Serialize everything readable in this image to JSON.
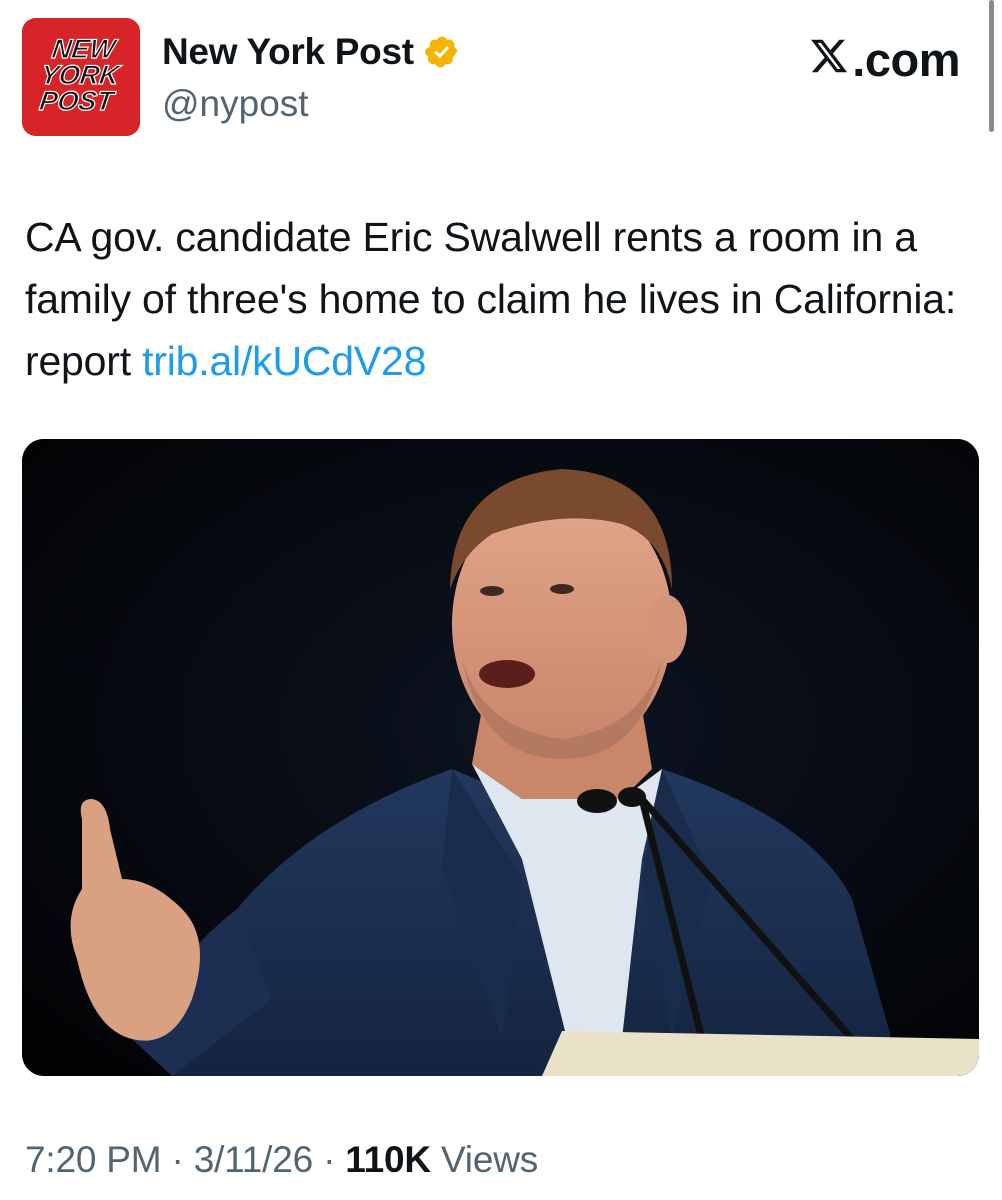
{
  "account": {
    "display_name": "New York Post",
    "handle": "@nypost",
    "verified_badge_color": "#f4b400",
    "avatar_bg_color": "#d62428",
    "avatar_logo_lines": [
      "NEW",
      "YORK",
      "POST"
    ]
  },
  "site_label": ".com",
  "tweet": {
    "text": "CA gov. candidate Eric Swalwell rents a room in a family of three's home to claim he lives in California: report ",
    "link": "trib.al/kUCdV28",
    "link_color": "#1d9bf0"
  },
  "meta": {
    "time": "7:20 PM",
    "separator": " · ",
    "date": "3/11/26",
    "views_count": "110K",
    "views_label": " Views"
  },
  "icons": {
    "verified": "verified-badge-icon",
    "x_logo": "x-logo-icon"
  }
}
